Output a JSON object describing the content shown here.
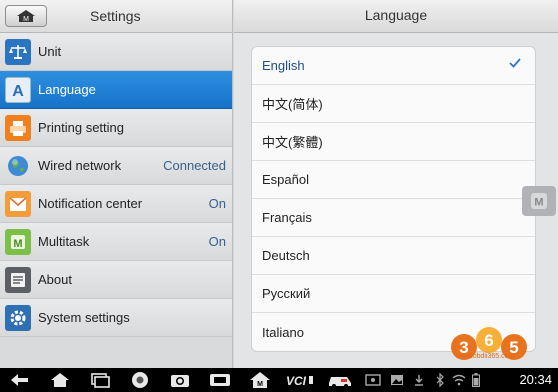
{
  "left_header": {
    "title": "Settings"
  },
  "menu": [
    {
      "label": "Unit",
      "value": "",
      "icon": "scale-icon"
    },
    {
      "label": "Language",
      "value": "",
      "icon": "language-icon",
      "active": true
    },
    {
      "label": "Printing setting",
      "value": "",
      "icon": "printer-icon"
    },
    {
      "label": "Wired network",
      "value": "Connected",
      "icon": "globe-icon"
    },
    {
      "label": "Notification center",
      "value": "On",
      "icon": "notification-icon"
    },
    {
      "label": "Multitask",
      "value": "On",
      "icon": "multitask-icon"
    },
    {
      "label": "About",
      "value": "",
      "icon": "about-icon"
    },
    {
      "label": "System settings",
      "value": "",
      "icon": "system-settings-icon"
    }
  ],
  "right_header": {
    "title": "Language"
  },
  "languages": [
    {
      "label": "English",
      "selected": true
    },
    {
      "label": "中文(简体)"
    },
    {
      "label": "中文(繁體)"
    },
    {
      "label": "Español"
    },
    {
      "label": "Français"
    },
    {
      "label": "Deutsch"
    },
    {
      "label": "Русский"
    },
    {
      "label": "Italiano"
    }
  ],
  "watermark": {
    "logo": "365",
    "url": "www.obdii365.com"
  },
  "status_bar": {
    "time": "20:34"
  },
  "colors": {
    "accent": "#1d7ad4",
    "watermark": "#e8731f"
  }
}
